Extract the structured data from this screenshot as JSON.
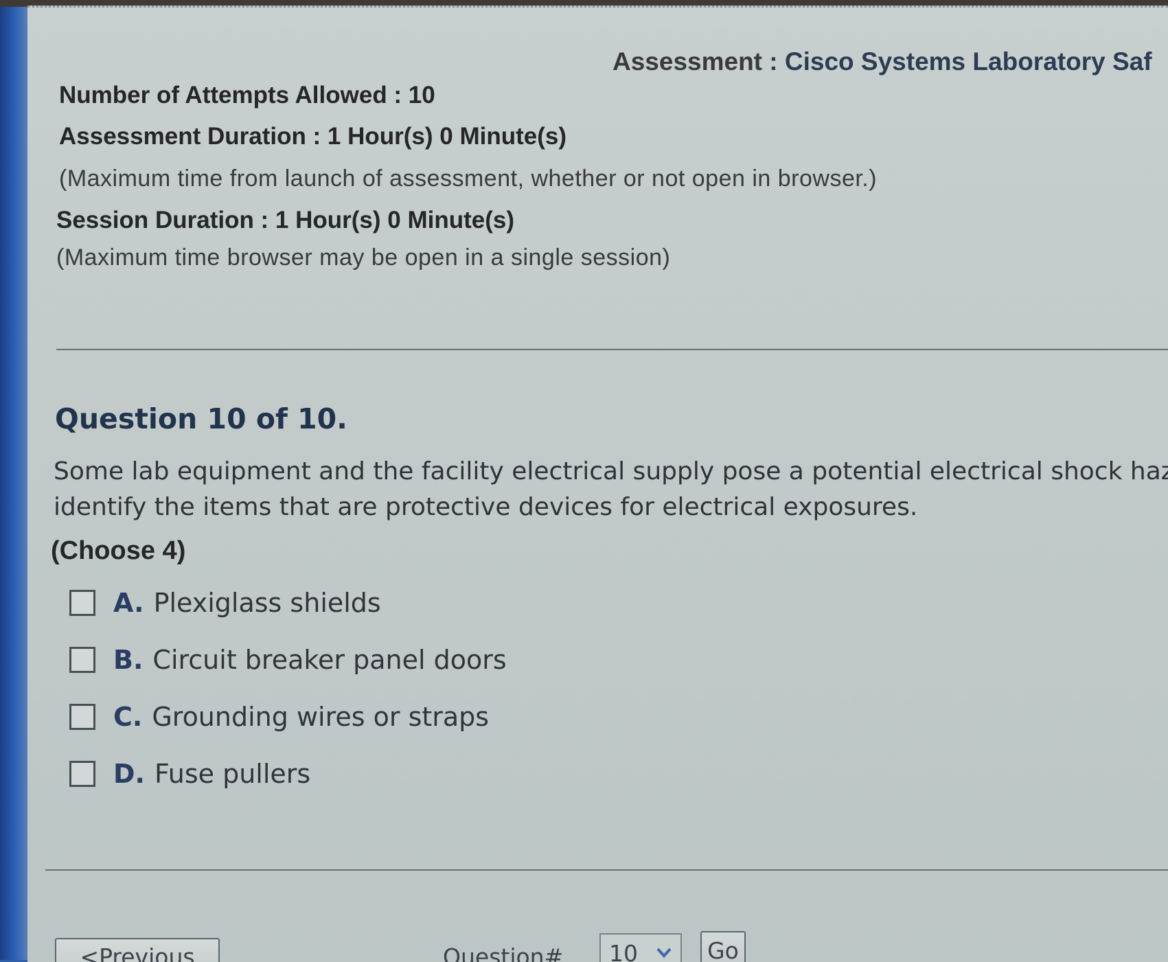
{
  "header": {
    "assessment_label": "Assessment : ",
    "assessment_value": "Cisco Systems Laboratory Saf"
  },
  "info": {
    "attempts": "Number of Attempts Allowed : 10",
    "assessment_duration": "Assessment Duration : 1 Hour(s) 0 Minute(s)",
    "assessment_duration_note": "(Maximum time from launch of assessment, whether or not open in browser.)",
    "session_duration": "Session Duration : 1 Hour(s) 0 Minute(s)",
    "session_duration_note": "(Maximum time browser may be open in a single session)"
  },
  "question": {
    "header": "Question 10 of 10.",
    "text_line1": "Some lab equipment and the facility electrical supply pose a potential electrical shock haz",
    "text_line2": "identify the items that are protective devices for electrical exposures.",
    "choose": "(Choose 4)",
    "options": [
      {
        "letter": "A.",
        "text": "Plexiglass shields",
        "checked": false
      },
      {
        "letter": "B.",
        "text": "Circuit breaker panel doors",
        "checked": false
      },
      {
        "letter": "C.",
        "text": "Grounding wires or straps",
        "checked": false
      },
      {
        "letter": "D.",
        "text": "Fuse pullers",
        "checked": false
      }
    ]
  },
  "navigation": {
    "previous_label": "<Previous",
    "question_number_label": "Question#",
    "question_number_selected": "10",
    "go_label": "Go"
  },
  "icons": {
    "dropdown": "chevron-down-icon"
  },
  "colors": {
    "page_background": "#c4cccc",
    "question_header": "#22344d",
    "option_letter": "#2a3d63",
    "monitor_bezel": "#2f5fa8"
  }
}
